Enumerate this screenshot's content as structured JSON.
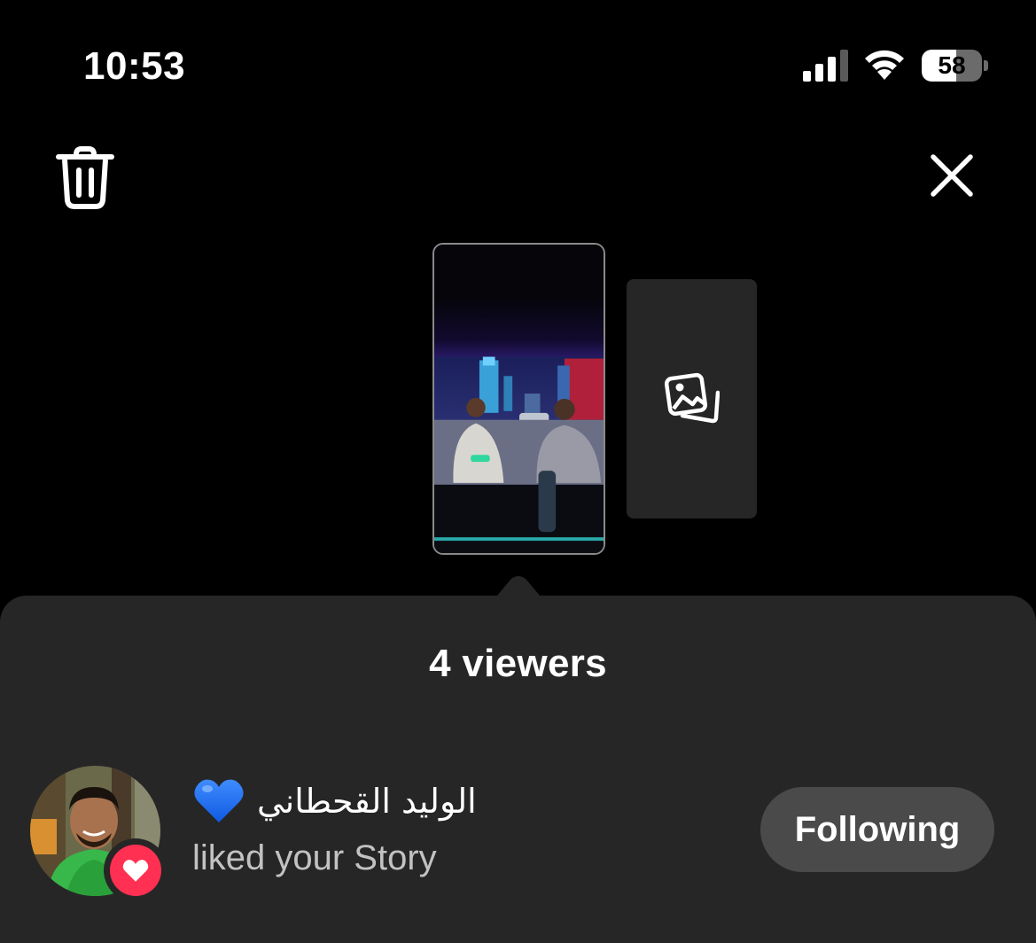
{
  "status_bar": {
    "time": "10:53",
    "battery_level": "58",
    "battery_fraction": 0.58
  },
  "top_bar": {
    "delete_icon": "trash-icon",
    "close_icon": "close-icon"
  },
  "stories": {
    "add_icon": "gallery-icon"
  },
  "viewers_panel": {
    "title": "4 viewers",
    "viewers": [
      {
        "name": "الوليد القحطاني",
        "name_emoji": "blue-heart",
        "activity": "liked your Story",
        "action_label": "Following",
        "badge_icon": "heart-icon"
      }
    ]
  },
  "colors": {
    "background": "#000000",
    "sheet": "#262626",
    "button": "#4a4a4a",
    "like": "#ff3051",
    "blue_heart": "#1e6ef0"
  }
}
